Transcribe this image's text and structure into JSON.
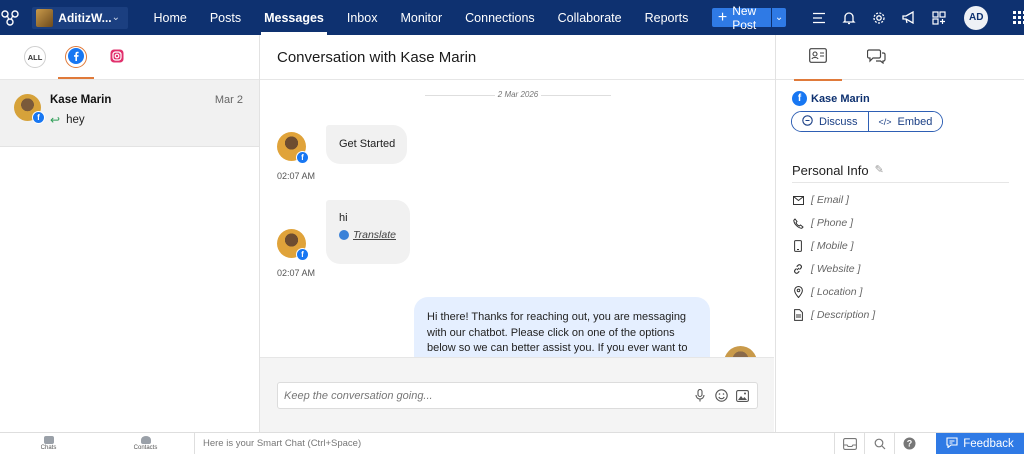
{
  "topbar": {
    "brand_name": "AditizW...",
    "nav": [
      "Home",
      "Posts",
      "Messages",
      "Inbox",
      "Monitor",
      "Connections",
      "Collaborate",
      "Reports"
    ],
    "active_nav": "Messages",
    "new_post_label": "New Post",
    "user_initials": "AD",
    "icons": [
      "app-logo-icon",
      "list-icon",
      "bell-icon",
      "gear-icon",
      "megaphone-icon",
      "widgets-icon",
      "apps-grid-icon"
    ]
  },
  "left": {
    "filters": {
      "all_label": "ALL",
      "facebook": "facebook-icon",
      "instagram": "instagram-icon"
    },
    "conversations": [
      {
        "name": "Kase Marin",
        "date": "Mar 2",
        "last_message": "hey"
      }
    ]
  },
  "middle": {
    "title": "Conversation with Kase Marin",
    "date_separator": "2 Mar 2026",
    "messages": [
      {
        "text": "Get Started",
        "time": "02:07 AM"
      },
      {
        "text": "hi",
        "translate_label": "Translate",
        "time": "02:07 AM"
      },
      {
        "text": "Hi there! Thanks for reaching out, you are messaging with our chatbot. Please click on one of the options below so we can better assist you. If you ever want to"
      }
    ],
    "composer_placeholder": "Keep the conversation going..."
  },
  "right": {
    "contact_name": "Kase Marin",
    "discuss_label": "Discuss",
    "embed_label": "Embed",
    "personal_info_title": "Personal Info",
    "fields": [
      "[ Email ]",
      "[ Phone ]",
      "[ Mobile ]",
      "[ Website ]",
      "[ Location ]",
      "[ Description ]"
    ]
  },
  "bottom": {
    "chats_label": "Chats",
    "contacts_label": "Contacts",
    "smart_chat_placeholder": "Here is your Smart Chat (Ctrl+Space)",
    "feedback_label": "Feedback"
  }
}
